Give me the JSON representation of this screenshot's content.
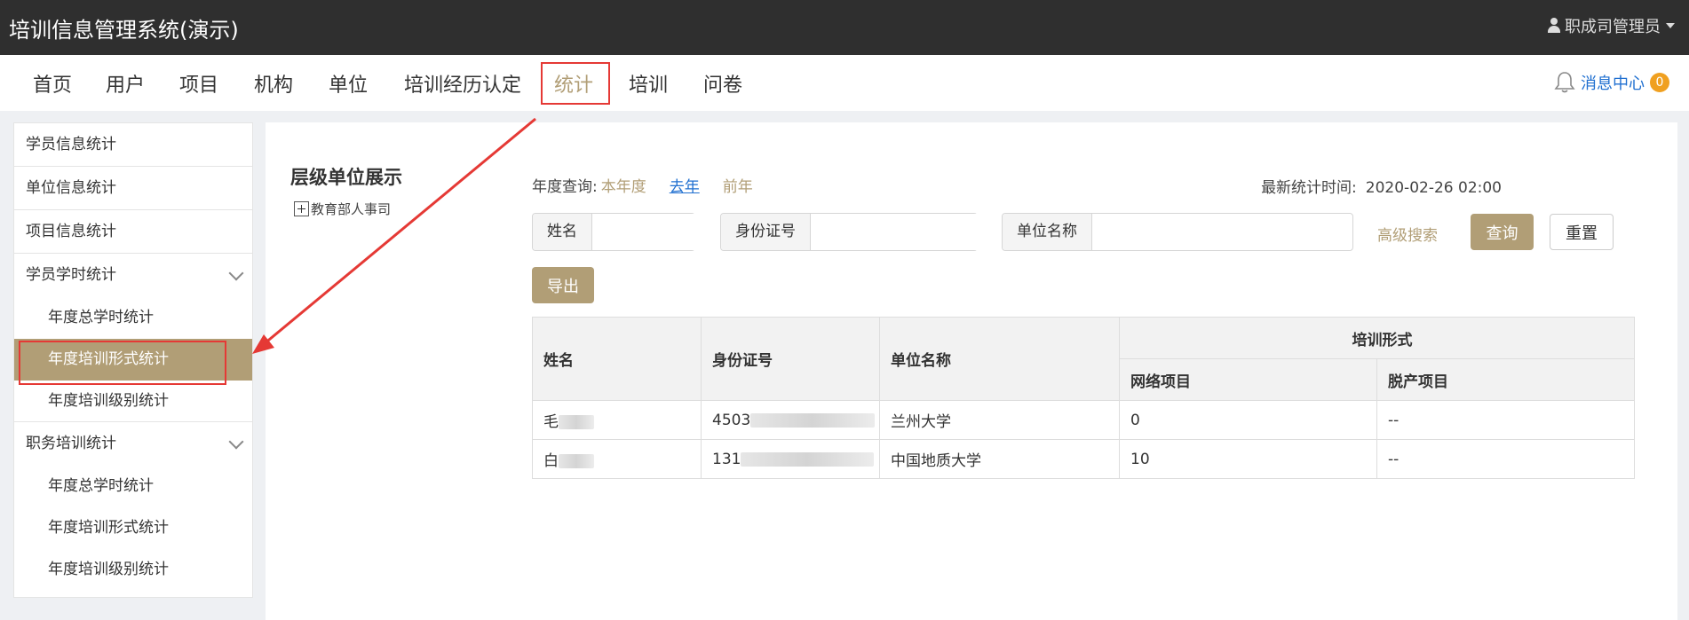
{
  "app": {
    "title": "培训信息管理系统(演示)",
    "user": "职成司管理员"
  },
  "nav": {
    "items": [
      "首页",
      "用户",
      "项目",
      "机构",
      "单位",
      "培训经历认定",
      "统计",
      "培训",
      "问卷"
    ],
    "active_index": 6,
    "message_center": {
      "label": "消息中心",
      "count": "0"
    }
  },
  "sidebar": {
    "groups": [
      {
        "label": "学员信息统计"
      },
      {
        "label": "单位信息统计"
      },
      {
        "label": "项目信息统计"
      },
      {
        "label": "学员学时统计",
        "children": [
          "年度总学时统计",
          "年度培训形式统计",
          "年度培训级别统计"
        ]
      },
      {
        "label": "职务培训统计",
        "children": [
          "年度总学时统计",
          "年度培训形式统计",
          "年度培训级别统计"
        ]
      }
    ],
    "active": "年度培训形式统计"
  },
  "tree": {
    "title": "层级单位展示",
    "root": "教育部人事司"
  },
  "filters": {
    "year_label": "年度查询:",
    "year_options": [
      "本年度",
      "去年",
      "前年"
    ],
    "selected_year": "去年",
    "stat_time_label": "最新统计时间:",
    "stat_time_value": "2020-02-26 02:00",
    "name_label": "姓名",
    "name_value": "",
    "id_label": "身份证号",
    "id_value": "",
    "unit_label": "单位名称",
    "unit_value": "",
    "advanced": "高级搜索",
    "query": "查询",
    "reset": "重置",
    "export": "导出"
  },
  "table": {
    "headers": {
      "name": "姓名",
      "id": "身份证号",
      "unit": "单位名称",
      "group": "培训形式",
      "online": "网络项目",
      "offline": "脱产项目"
    },
    "rows": [
      {
        "name": "毛",
        "id": "4503",
        "unit": "兰州大学",
        "online": "0",
        "offline": "--"
      },
      {
        "name": "白",
        "id": "131",
        "unit": "中国地质大学",
        "online": "10",
        "offline": "--"
      }
    ]
  },
  "colors": {
    "accent": "#b19e76",
    "topbar": "#2f2f2f",
    "link": "#1f6fd0",
    "highlight": "#e53935"
  }
}
